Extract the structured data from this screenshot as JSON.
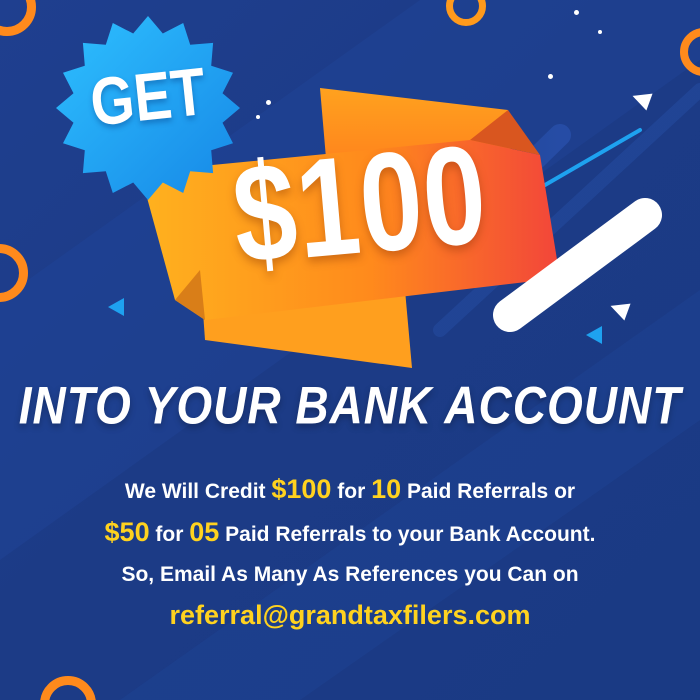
{
  "badge": {
    "text": "GET"
  },
  "amount": {
    "text": "$100"
  },
  "headline": "INTO YOUR BANK ACCOUNT",
  "body": {
    "line1": {
      "prefix": "We Will Credit ",
      "hl1": "$100",
      "mid1": " for ",
      "hl2": "10",
      "suffix": " Paid Referrals or"
    },
    "line2": {
      "hl1": "$50",
      "mid1": " for ",
      "hl2": "05",
      "suffix": " Paid Referrals to your Bank Account."
    },
    "line3": "So, Email As Many As References you Can on",
    "email": "referral@grandtaxfilers.com"
  },
  "colors": {
    "background": "#1d3c88",
    "accent_yellow": "#ffd21f",
    "badge_blue": "#1aa3f0",
    "banner_orange": "#ff9a1a",
    "banner_red": "#f2473a",
    "ring_orange": "#ff8a1c"
  }
}
